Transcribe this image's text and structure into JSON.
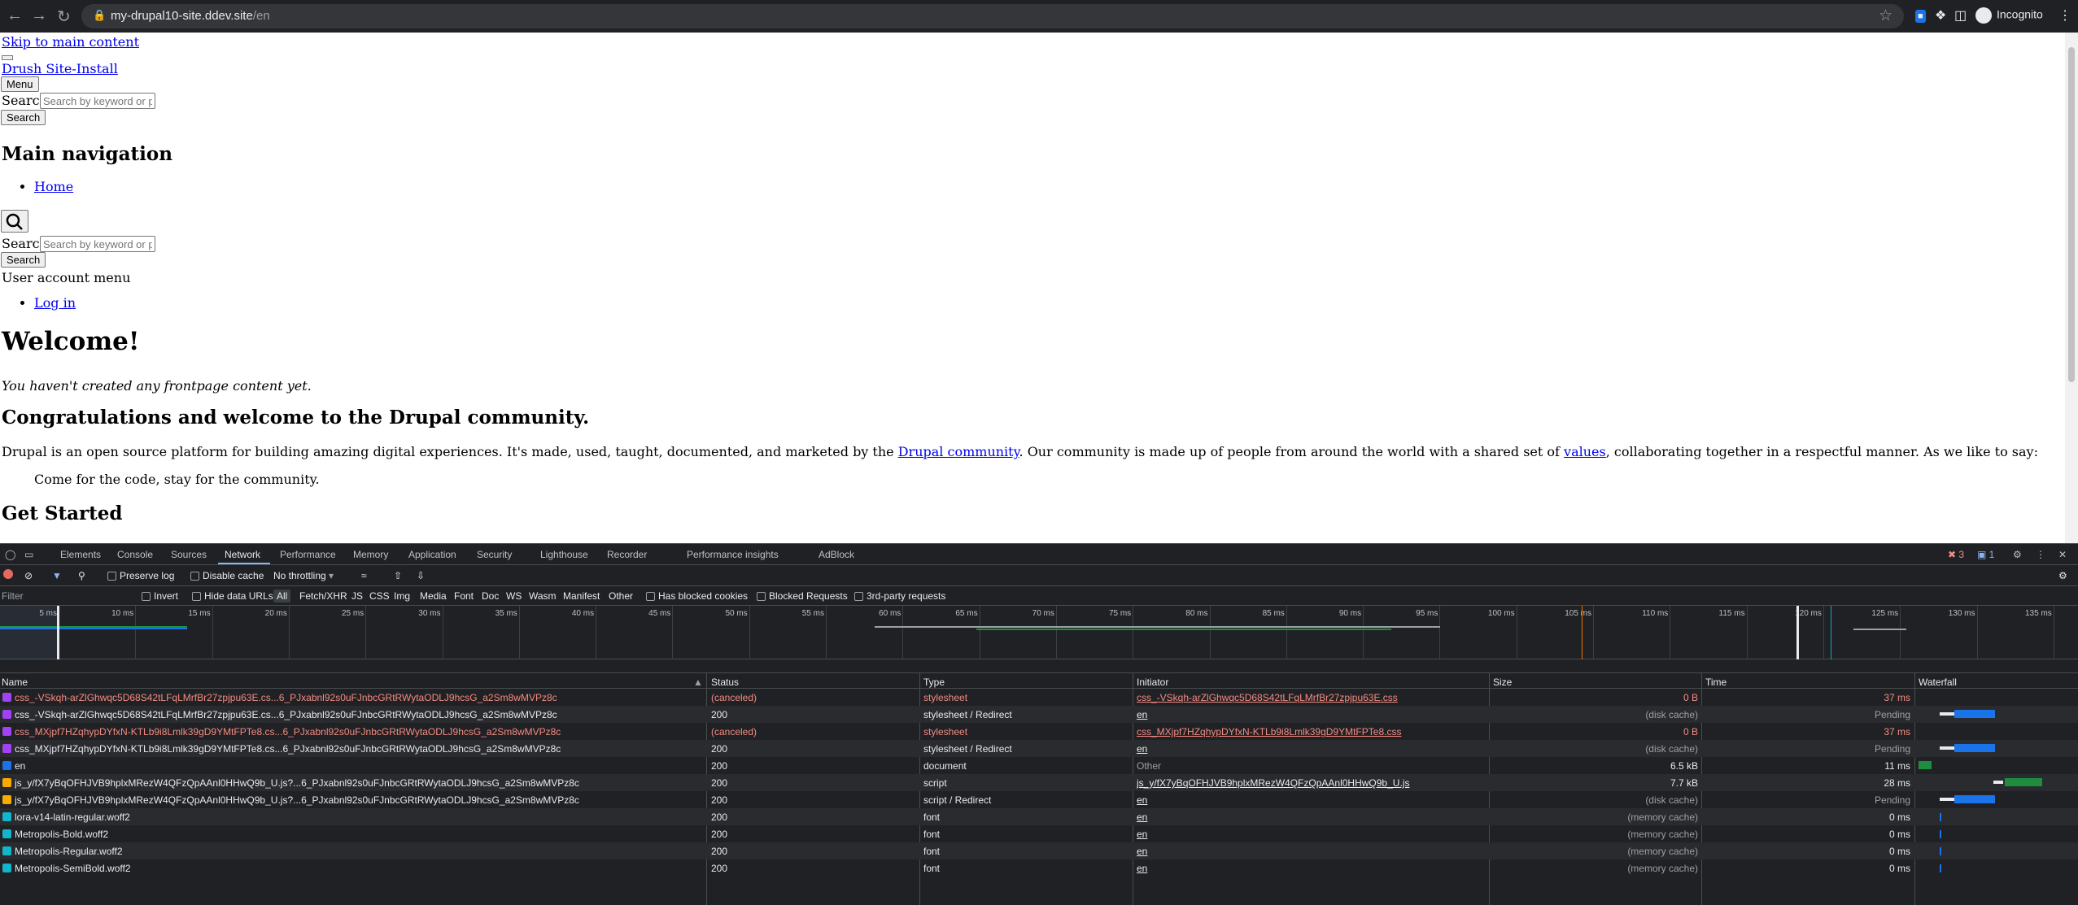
{
  "browser": {
    "url_host": "my-drupal10-site.ddev.site",
    "url_path": "/en",
    "profile_label": "Incognito"
  },
  "page": {
    "skip_link": "Skip to main content",
    "site_name": "Drush Site-Install",
    "menu_button": "Menu",
    "search_label": "Search",
    "search_placeholder": "Search by keyword or phrase.",
    "search_button": "Search",
    "main_nav_heading": "Main navigation",
    "home_link": "Home",
    "search_label_2": "Search",
    "search_placeholder_2": "Search by keyword or phrase.",
    "search_button_2": "Search",
    "user_menu_label": "User account menu",
    "login_link": "Log in",
    "welcome_heading": "Welcome!",
    "no_content": "You haven't created any frontpage content yet.",
    "congrats_heading": "Congratulations and welcome to the Drupal community.",
    "intro_part1": "Drupal is an open source platform for building amazing digital experiences. It's made, used, taught, documented, and marketed by the",
    "community_link": "Drupal community",
    "intro_part2": ". Our community is made up of people from around the world with a shared set of",
    "values_link": "values",
    "intro_part3": ", collaborating together in a respectful manner. As we like to say:",
    "quote": "Come for the code, stay for the community.",
    "get_started_heading": "Get Started"
  },
  "devtools": {
    "tabs": [
      "Elements",
      "Console",
      "Sources",
      "Network",
      "Performance",
      "Memory",
      "Application",
      "Security",
      "Lighthouse",
      "Recorder",
      "Performance insights",
      "AdBlock"
    ],
    "error_count": "3",
    "message_count": "1",
    "toolbar": {
      "preserve_log": "Preserve log",
      "disable_cache": "Disable cache",
      "throttling": "No throttling"
    },
    "filter": {
      "placeholder": "Filter",
      "invert": "Invert",
      "hide_data_urls": "Hide data URLs",
      "types": [
        "All",
        "Fetch/XHR",
        "JS",
        "CSS",
        "Img",
        "Media",
        "Font",
        "Doc",
        "WS",
        "Wasm",
        "Manifest",
        "Other"
      ],
      "has_blocked_cookies": "Has blocked cookies",
      "blocked_requests": "Blocked Requests",
      "third_party": "3rd-party requests"
    },
    "timeline_ticks": [
      "5 ms",
      "10 ms",
      "15 ms",
      "20 ms",
      "25 ms",
      "30 ms",
      "35 ms",
      "40 ms",
      "45 ms",
      "50 ms",
      "55 ms",
      "60 ms",
      "65 ms",
      "70 ms",
      "75 ms",
      "80 ms",
      "85 ms",
      "90 ms",
      "95 ms",
      "100 ms",
      "105 ms",
      "110 ms",
      "115 ms",
      "120 ms",
      "125 ms",
      "130 ms",
      "135 ms"
    ],
    "columns": {
      "name": "Name",
      "status": "Status",
      "type": "Type",
      "initiator": "Initiator",
      "size": "Size",
      "time": "Time",
      "waterfall": "Waterfall"
    },
    "rows": [
      {
        "name": "css_-VSkqh-arZlGhwqc5D68S42tLFqLMrfBr27zpjpu63E.cs...6_PJxabnl92s0uFJnbcGRtRWytaODLJ9hcsG_a2Sm8wMVPz8c",
        "status": "(canceled)",
        "type": "stylesheet",
        "initiator": "css_-VSkqh-arZlGhwqc5D68S42tLFqLMrfBr27zpjpu63E.css",
        "size": "0 B",
        "time": "37 ms",
        "icon": "css",
        "error": true
      },
      {
        "name": "css_-VSkqh-arZlGhwqc5D68S42tLFqLMrfBr27zpjpu63E.cs...6_PJxabnl92s0uFJnbcGRtRWytaODLJ9hcsG_a2Sm8wMVPz8c",
        "status": "200",
        "type": "stylesheet / Redirect",
        "initiator": "en",
        "size": "(disk cache)",
        "time": "Pending",
        "icon": "css",
        "error": false
      },
      {
        "name": "css_MXjpf7HZqhypDYfxN-KTLb9i8Lmlk39gD9YMtFPTe8.cs...6_PJxabnl92s0uFJnbcGRtRWytaODLJ9hcsG_a2Sm8wMVPz8c",
        "status": "(canceled)",
        "type": "stylesheet",
        "initiator": "css_MXjpf7HZqhypDYfxN-KTLb9i8Lmlk39gD9YMtFPTe8.css",
        "size": "0 B",
        "time": "37 ms",
        "icon": "css",
        "error": true
      },
      {
        "name": "css_MXjpf7HZqhypDYfxN-KTLb9i8Lmlk39gD9YMtFPTe8.cs...6_PJxabnl92s0uFJnbcGRtRWytaODLJ9hcsG_a2Sm8wMVPz8c",
        "status": "200",
        "type": "stylesheet / Redirect",
        "initiator": "en",
        "size": "(disk cache)",
        "time": "Pending",
        "icon": "css",
        "error": false
      },
      {
        "name": "en",
        "status": "200",
        "type": "document",
        "initiator": "Other",
        "size": "6.5 kB",
        "time": "11 ms",
        "icon": "doc",
        "error": false
      },
      {
        "name": "js_y/fX7yBqOFHJVB9hplxMRezW4QFzQpAAnl0HHwQ9b_U.js?...6_PJxabnl92s0uFJnbcGRtRWytaODLJ9hcsG_a2Sm8wMVPz8c",
        "status": "200",
        "type": "script",
        "initiator": "js_y/fX7yBqOFHJVB9hplxMRezW4QFzQpAAnl0HHwQ9b_U.js",
        "size": "7.7 kB",
        "time": "28 ms",
        "icon": "js",
        "error": false
      },
      {
        "name": "js_y/fX7yBqOFHJVB9hplxMRezW4QFzQpAAnl0HHwQ9b_U.js?...6_PJxabnl92s0uFJnbcGRtRWytaODLJ9hcsG_a2Sm8wMVPz8c",
        "status": "200",
        "type": "script / Redirect",
        "initiator": "en",
        "size": "(disk cache)",
        "time": "Pending",
        "icon": "js",
        "error": false
      },
      {
        "name": "lora-v14-latin-regular.woff2",
        "status": "200",
        "type": "font",
        "initiator": "en",
        "size": "(memory cache)",
        "time": "0 ms",
        "icon": "font",
        "error": false
      },
      {
        "name": "Metropolis-Bold.woff2",
        "status": "200",
        "type": "font",
        "initiator": "en",
        "size": "(memory cache)",
        "time": "0 ms",
        "icon": "font",
        "error": false
      },
      {
        "name": "Metropolis-Regular.woff2",
        "status": "200",
        "type": "font",
        "initiator": "en",
        "size": "(memory cache)",
        "time": "0 ms",
        "icon": "font",
        "error": false
      },
      {
        "name": "Metropolis-SemiBold.woff2",
        "status": "200",
        "type": "font",
        "initiator": "en",
        "size": "(memory cache)",
        "time": "0 ms",
        "icon": "font",
        "error": false
      }
    ],
    "colors": {
      "accent": "#8ab4f8",
      "error_text": "#f28b82",
      "waterfall_blue": "#1a73e8",
      "waterfall_green": "#1e8e3e"
    }
  }
}
